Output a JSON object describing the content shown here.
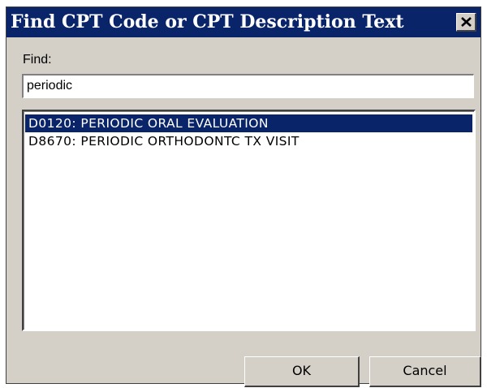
{
  "window": {
    "title": "Find CPT Code or CPT Description Text",
    "close_icon": "close-icon"
  },
  "find": {
    "label": "Find:",
    "value": "periodic"
  },
  "results": [
    {
      "text": "D0120:  PERIODIC ORAL EVALUATION",
      "selected": true
    },
    {
      "text": "D8670:  PERIODIC ORTHODONTC TX VISIT",
      "selected": false
    }
  ],
  "buttons": {
    "ok_label": "OK",
    "cancel_label": "Cancel"
  },
  "colors": {
    "titlebar": "#0a246a",
    "dialog_face": "#d4d0c8",
    "selection": "#0a246a"
  }
}
